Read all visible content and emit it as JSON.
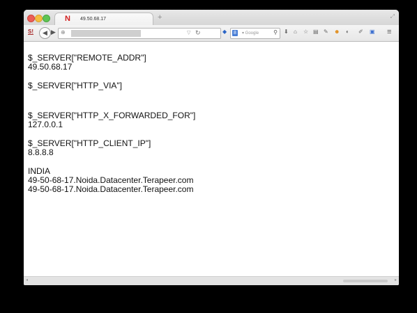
{
  "browser": {
    "tab": {
      "favicon": "N",
      "title": "49.50.68.17"
    },
    "new_tab_icon": "+",
    "toolbar": {
      "addon_label": "S!",
      "search_engine_letter": "8",
      "search_placeholder": "▾ Google",
      "icons": [
        "download-icon",
        "home-icon",
        "star-icon",
        "clipboard-icon",
        "addon-icon",
        "smiley-icon",
        "chat-icon",
        "tools-icon",
        "screenshot-icon"
      ]
    }
  },
  "page": {
    "lines": [
      "$_SERVER[\"REMOTE_ADDR\"]",
      "49.50.68.17",
      "$_SERVER[\"HTTP_VIA\"]",
      "$_SERVER[\"HTTP_X_FORWARDED_FOR\"]",
      "127.0.0.1",
      "$_SERVER[\"HTTP_CLIENT_IP\"]",
      "8.8.8.8",
      "INDIA",
      "49-50-68-17.Noida.Datacenter.Terapeer.com",
      "49-50-68-17.Noida.Datacenter.Terapeer.com"
    ]
  }
}
